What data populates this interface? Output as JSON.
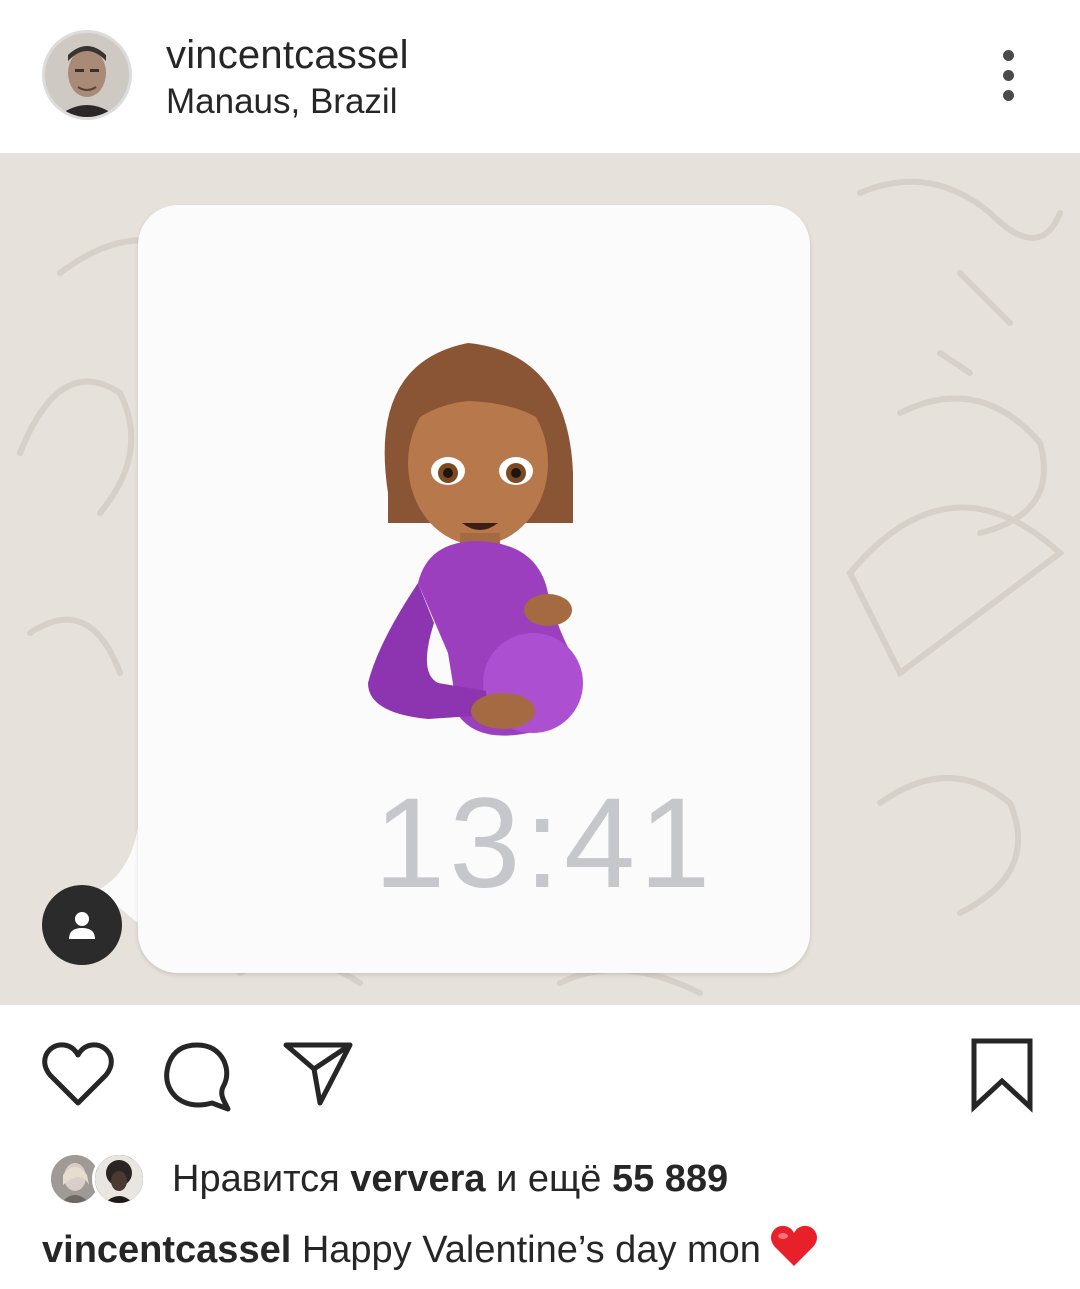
{
  "post": {
    "username": "vincentcassel",
    "location": "Manaus, Brazil"
  },
  "image": {
    "message_time": "13:41",
    "emoji_name": "pregnant-woman-emoji"
  },
  "actions": {
    "icons": [
      "heart-icon",
      "comment-icon",
      "share-icon",
      "bookmark-icon"
    ]
  },
  "likes": {
    "prefix": "Нравится",
    "liker": "ververa",
    "middle": "и ещё",
    "count": "55 889"
  },
  "caption": {
    "username": "vincentcassel",
    "text": "Happy Valentine’s day mon"
  },
  "colors": {
    "text": "#262626",
    "bubble": "#fbfbfb",
    "chat_bg": "#e6e1da",
    "time": "#c6c7cb",
    "heart": "#e8202a"
  }
}
